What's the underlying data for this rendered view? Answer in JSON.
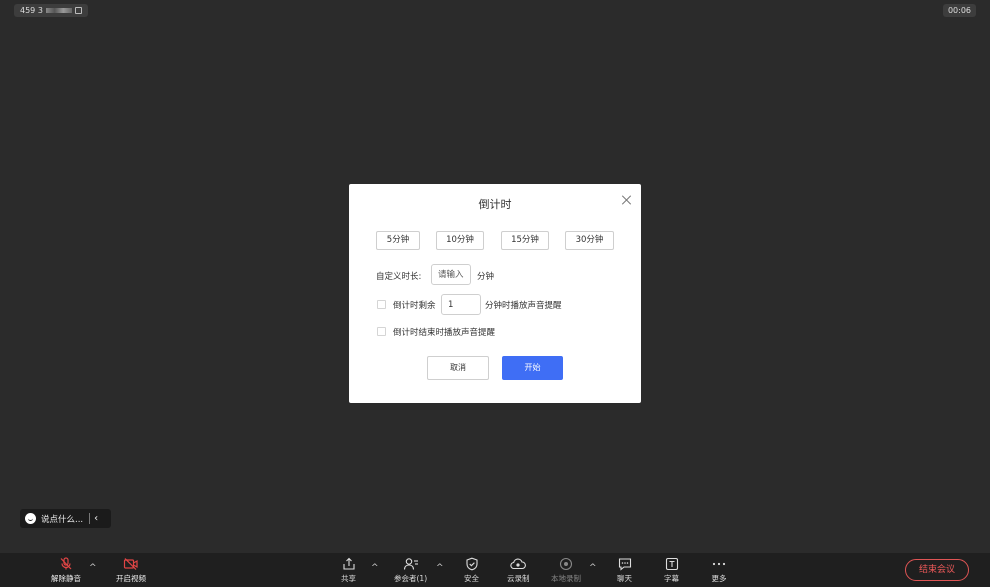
{
  "header": {
    "meeting_id": "459 3",
    "duration": "00:06"
  },
  "dialog": {
    "title": "倒计时",
    "presets": [
      "5分钟",
      "10分钟",
      "15分钟",
      "30分钟"
    ],
    "custom_label": "自定义时长:",
    "custom_placeholder": "请输入",
    "custom_unit": "分钟",
    "remind_prefix": "倒计时剩余",
    "remind_value": "1",
    "remind_suffix": "分钟时播放声音提醒",
    "end_remind": "倒计时结束时播放声音提醒",
    "cancel": "取消",
    "start": "开始"
  },
  "chat_bar": {
    "placeholder": "说点什么..."
  },
  "toolbar": {
    "unmute": "解除静音",
    "start_video": "开启视频",
    "share": "共享",
    "participants": "参会者(1)",
    "security": "安全",
    "cloud_record": "云录制",
    "local_record": "本地录制",
    "chat": "聊天",
    "captions": "字幕",
    "more": "更多",
    "end_meeting": "结束会议"
  },
  "colors": {
    "accent": "#3f6ef5",
    "danger": "#e05555",
    "background": "#2b2b2b"
  }
}
